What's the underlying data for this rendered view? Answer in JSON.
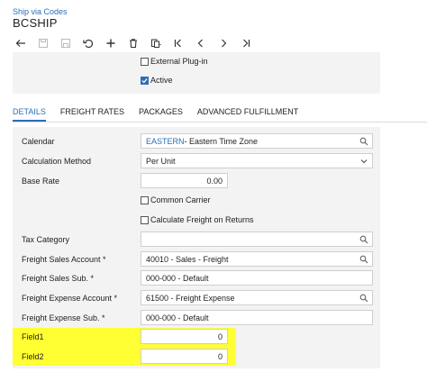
{
  "header": {
    "breadcrumb": "Ship via Codes",
    "title": "BCSHIP"
  },
  "toolbar": [
    "back-icon",
    "save-icon",
    "save-close-icon",
    "undo-icon",
    "add-icon",
    "delete-icon",
    "copy-paste-icon",
    "first-icon",
    "prev-icon",
    "next-icon",
    "last-icon"
  ],
  "top_panel": {
    "external_plugin": {
      "label": "External Plug-in",
      "checked": false
    },
    "active": {
      "label": "Active",
      "checked": true
    }
  },
  "tabs": [
    {
      "label": "DETAILS",
      "active": true
    },
    {
      "label": "FREIGHT RATES",
      "active": false
    },
    {
      "label": "PACKAGES",
      "active": false
    },
    {
      "label": "ADVANCED FULFILLMENT",
      "active": false
    }
  ],
  "form": {
    "calendar": {
      "label": "Calendar",
      "code": "EASTERN",
      "desc": " - Eastern Time Zone"
    },
    "calc_method": {
      "label": "Calculation Method",
      "value": "Per Unit"
    },
    "base_rate": {
      "label": "Base Rate",
      "value": "0.00"
    },
    "common_carrier": {
      "label": "Common Carrier",
      "checked": false
    },
    "calc_freight_returns": {
      "label": "Calculate Freight on Returns",
      "checked": false
    },
    "tax_category": {
      "label": "Tax Category",
      "value": ""
    },
    "freight_sales_account": {
      "label": "Freight Sales Account *",
      "value": "40010 - Sales - Freight"
    },
    "freight_sales_sub": {
      "label": "Freight Sales Sub. *",
      "value": "000-000 - Default"
    },
    "freight_expense_account": {
      "label": "Freight Expense Account *",
      "value": "61500 - Freight Expense"
    },
    "freight_expense_sub": {
      "label": "Freight Expense Sub. *",
      "value": "000-000 - Default"
    },
    "field1": {
      "label": "Field1",
      "value": "0"
    },
    "field2": {
      "label": "Field2",
      "value": "0"
    }
  },
  "colors": {
    "accent": "#2a6fba",
    "highlight": "#ffff33",
    "panel": "#f3f3f3"
  }
}
